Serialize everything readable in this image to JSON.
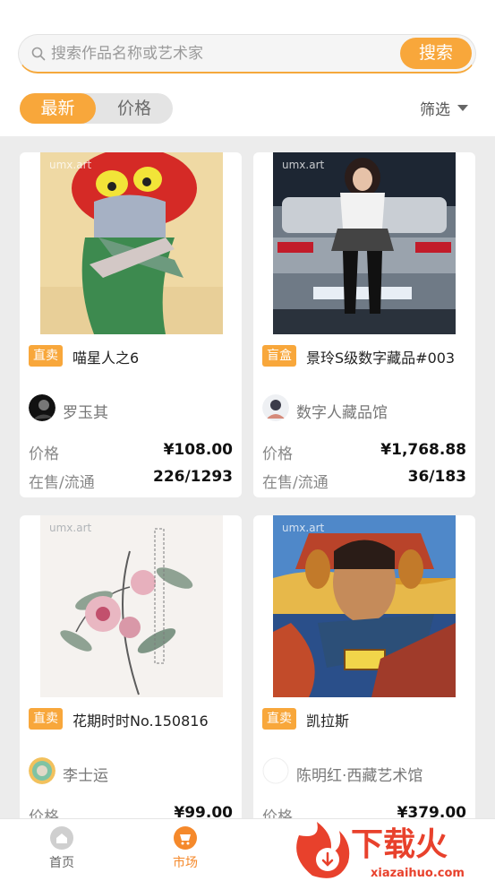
{
  "search": {
    "placeholder": "搜索作品名称或艺术家",
    "button_label": "搜索"
  },
  "sort": {
    "tabs": [
      "最新",
      "价格"
    ],
    "active": 0
  },
  "filter": {
    "label": "筛选"
  },
  "labels": {
    "price": "价格",
    "stock": "在售/流通"
  },
  "watermark": "umx.art",
  "products": [
    {
      "badge": "直卖",
      "title": "喵星人之6",
      "creator": "罗玉其",
      "price": "¥108.00",
      "stock": "226/1293"
    },
    {
      "badge": "盲盒",
      "title": "景玲S级数字藏品#003",
      "creator": "数字人藏品馆",
      "price": "¥1,768.88",
      "stock": "36/183"
    },
    {
      "badge": "直卖",
      "title": "花期时时No.150816",
      "creator": "李士运",
      "price": "¥99.00",
      "stock": ""
    },
    {
      "badge": "直卖",
      "title": "凯拉斯",
      "creator": "陈明红·西藏艺术馆",
      "price": "¥379.00",
      "stock": ""
    }
  ],
  "nav": [
    {
      "label": "首页",
      "icon": "home-icon",
      "color": "#666666"
    },
    {
      "label": "市场",
      "icon": "market-cart-icon",
      "color": "#f5892b"
    }
  ],
  "watermark_logo": {
    "text": "下载火",
    "url_text": "xiazaihuo.com"
  },
  "colors": {
    "accent": "#f8a73b",
    "market_active": "#f5892b",
    "logo_red": "#e8412c"
  }
}
